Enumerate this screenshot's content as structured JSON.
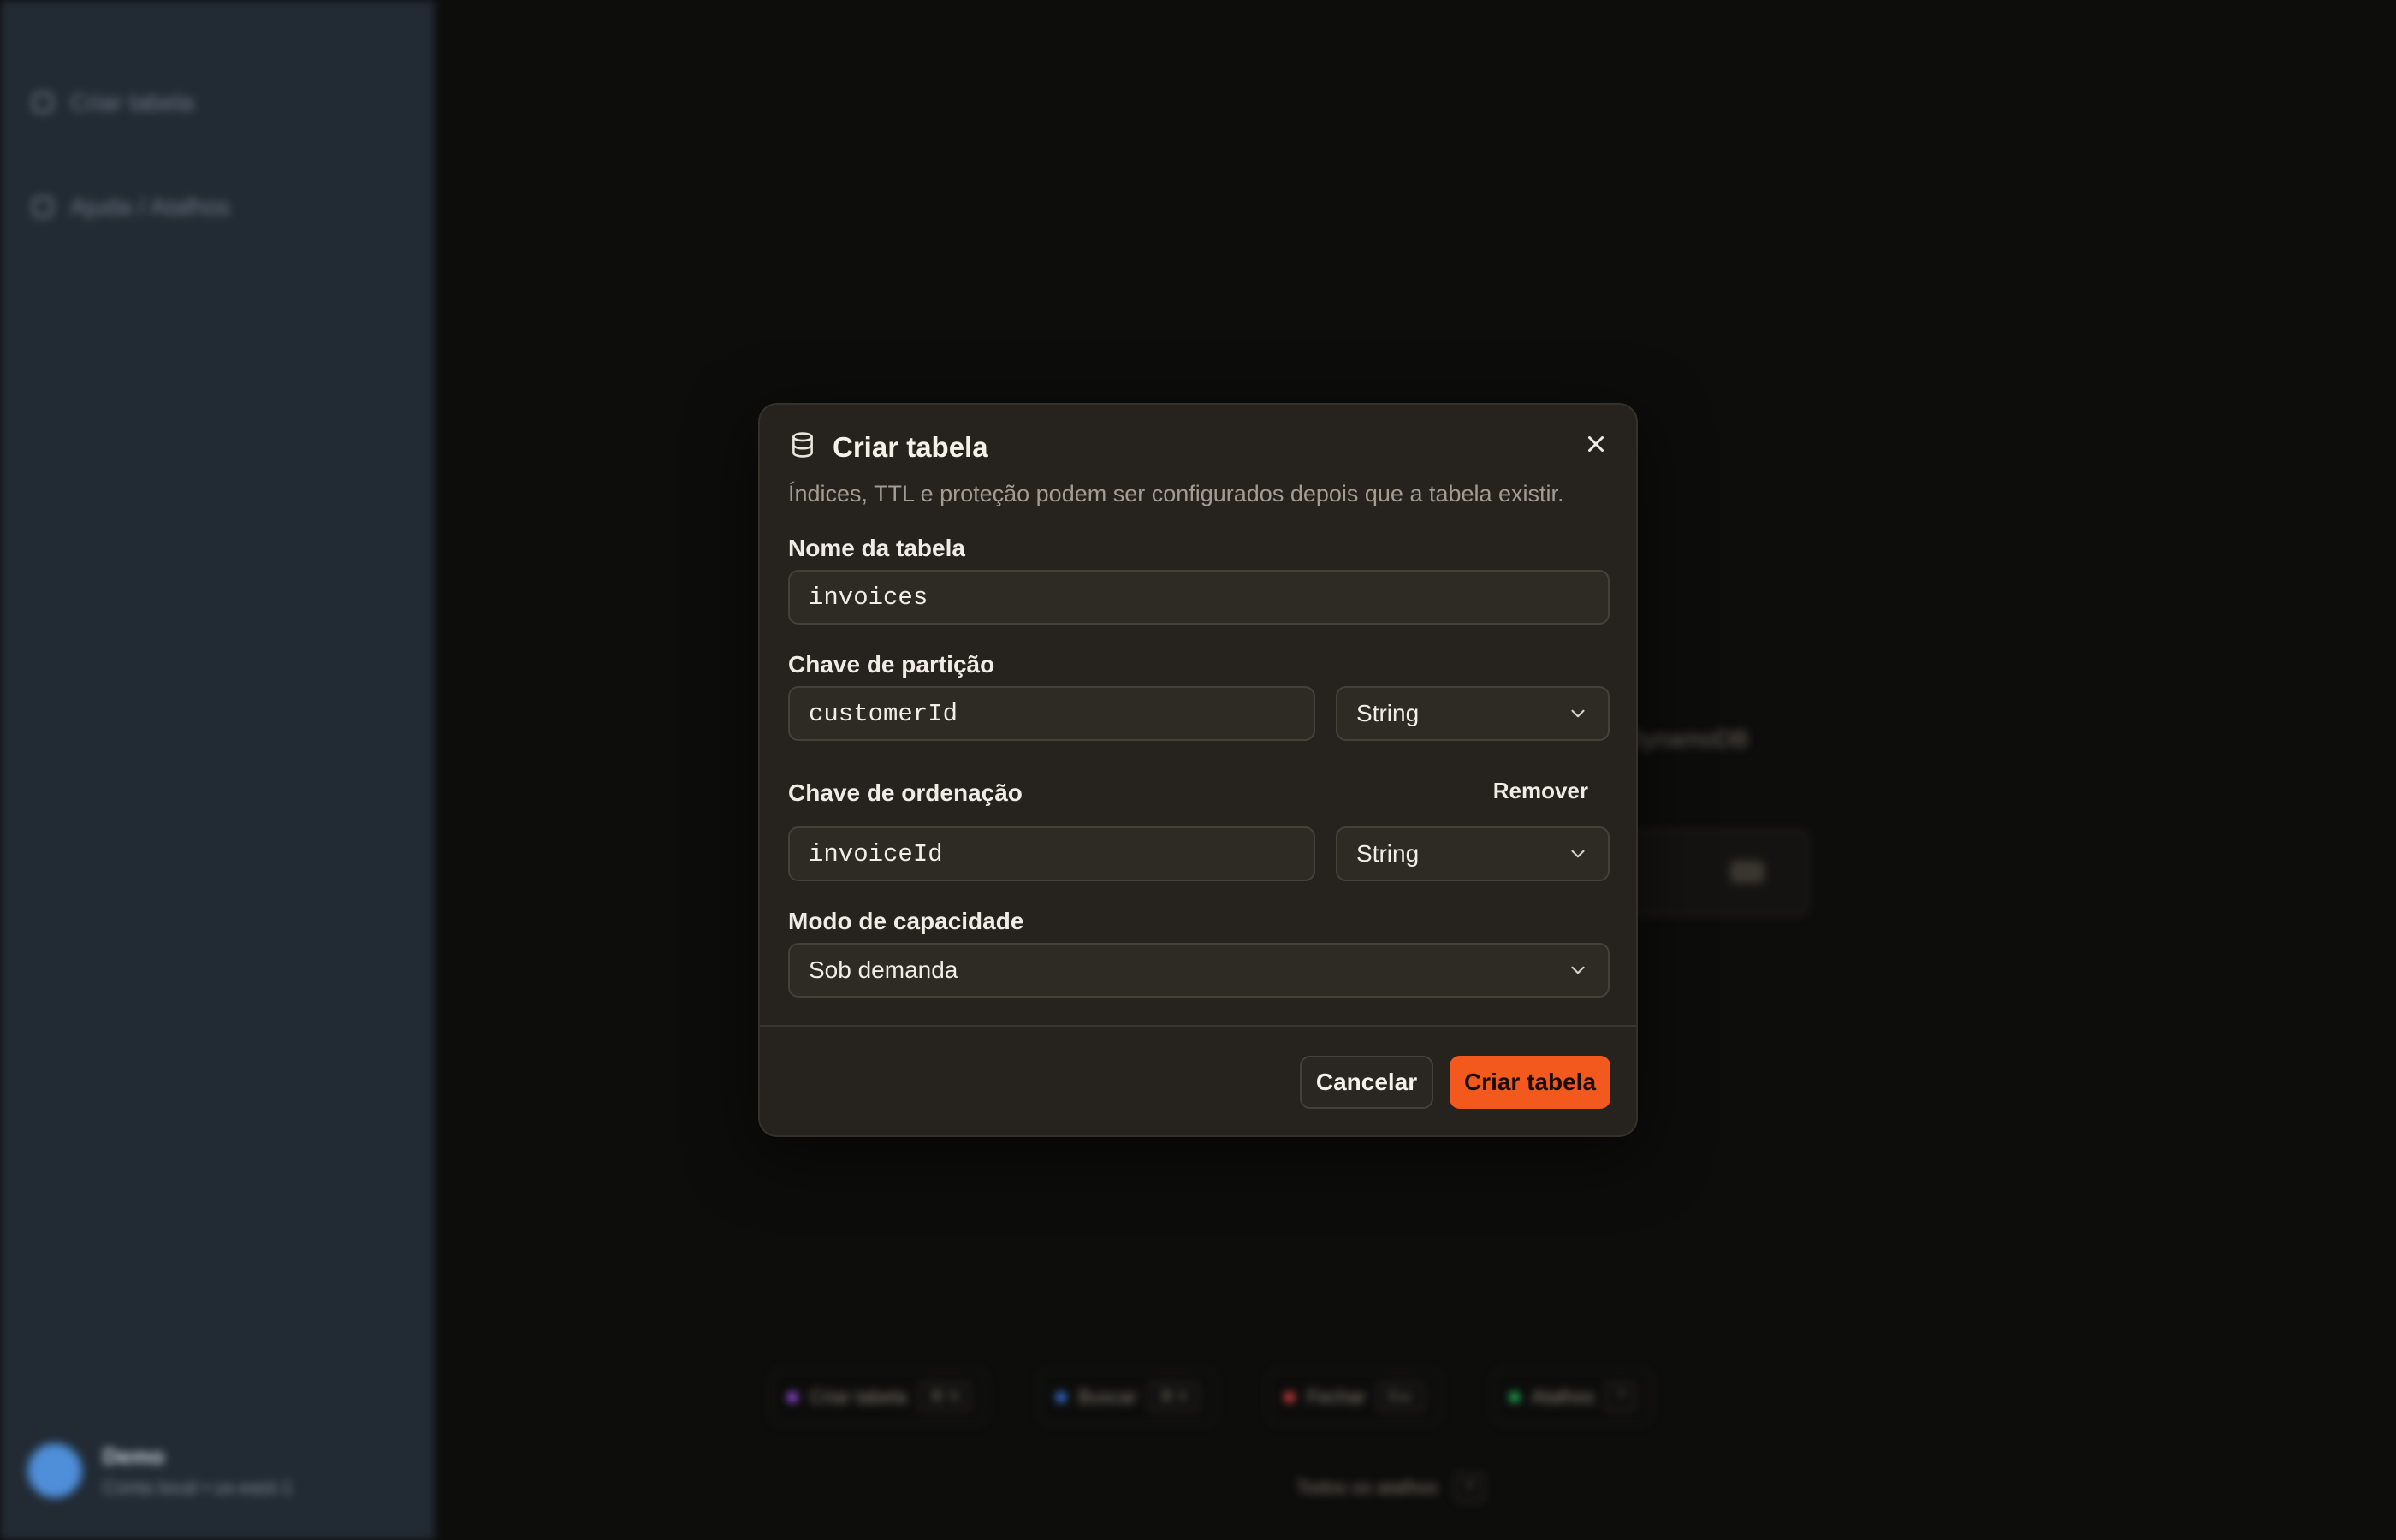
{
  "background": {
    "sidebar": {
      "items": [
        {
          "label": "Criar tabela",
          "icon": "plus-icon"
        },
        {
          "label": "Ajuda / Atalhos",
          "icon": "help-icon"
        }
      ],
      "user": {
        "name": "Demo",
        "subtitle": "Conta local • us-east-1"
      }
    },
    "main_text": "DynamoDB",
    "shortcuts": [
      {
        "label": "Criar tabela",
        "key": "⌘ N",
        "color": "#a855f7"
      },
      {
        "label": "Buscar",
        "key": "⌘ K",
        "color": "#3b82f6"
      },
      {
        "label": "Fechar",
        "key": "Esc",
        "color": "#ef4444"
      },
      {
        "label": "Atalhos",
        "key": "?",
        "color": "#22c55e"
      }
    ],
    "footer": {
      "label": "Todos os atalhos",
      "key": "?"
    }
  },
  "dialog": {
    "title": "Criar tabela",
    "title_icon": "database-icon",
    "description": "Índices, TTL e proteção podem ser configurados depois que a tabela existir.",
    "table_name": {
      "label": "Nome da tabela",
      "value": "invoices"
    },
    "partition_key": {
      "label": "Chave de partição",
      "value": "customerId",
      "type": "String"
    },
    "sort_key": {
      "label": "Chave de ordenação",
      "value": "invoiceId",
      "type": "String",
      "remove_label": "Remover"
    },
    "capacity_mode": {
      "label": "Modo de capacidade",
      "value": "Sob demanda"
    },
    "cancel_label": "Cancelar",
    "submit_label": "Criar tabela"
  },
  "colors": {
    "accent": "#f3591c",
    "dialog_bg": "#26231e",
    "sidebar_bg": "#222a33"
  }
}
